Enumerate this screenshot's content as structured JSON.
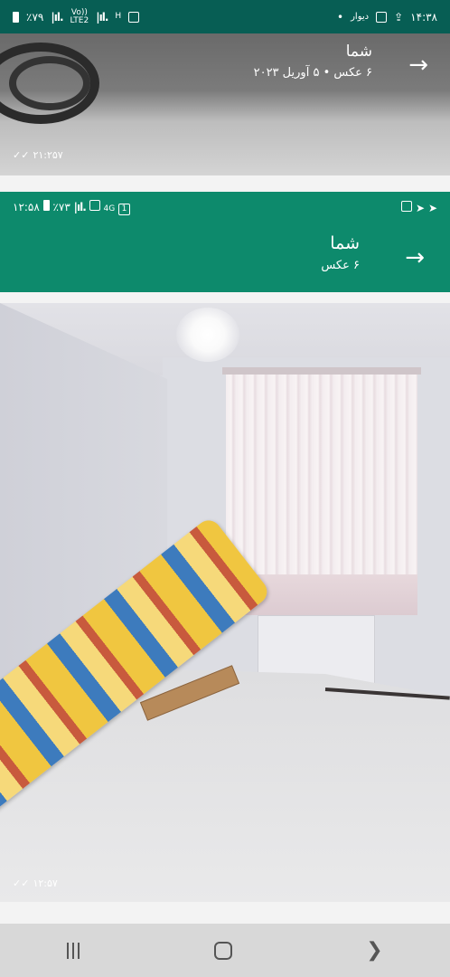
{
  "status_top": {
    "time": "۱۴:۳۸",
    "app_label": "دیوار",
    "battery": "٪۷۹",
    "net_label_1": "Vo))",
    "net_label_2": "LTE2",
    "net_h": "H"
  },
  "chat_top": {
    "title": "شما",
    "subtitle": "۶ عکس • ۵ آوریل ۲۰۲۳",
    "message_time": "۲۱:۲۵۷"
  },
  "status_inner": {
    "time": "۱۲:۵۸",
    "battery": "٪۷۳",
    "network": "4G",
    "sim": "1"
  },
  "chat_inner": {
    "title": "شما",
    "subtitle": "۶ عکس",
    "message_time": "۱۲:۵۷"
  },
  "icons": {
    "back_arrow": "→",
    "double_check": "✓✓",
    "nav_back": "❯"
  },
  "colors": {
    "header_dark": "#075e54",
    "header_green": "#0d8a6c"
  }
}
